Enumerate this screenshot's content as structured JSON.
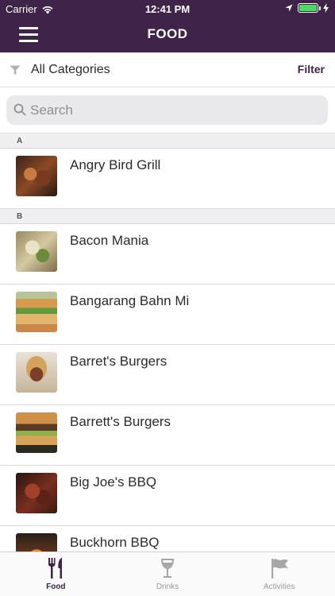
{
  "status_bar": {
    "carrier": "Carrier",
    "time": "12:41 PM",
    "battery_color": "#4cd964"
  },
  "nav": {
    "title": "FOOD",
    "menu_icon": "hamburger-menu-icon",
    "bar_color": "#3f2349"
  },
  "filter": {
    "category": "All Categories",
    "button_label": "Filter",
    "icon": "funnel-icon"
  },
  "search": {
    "placeholder": "Search",
    "value": ""
  },
  "sections": [
    {
      "letter": "A",
      "items": [
        {
          "name": "Angry Bird Grill",
          "thumb": "t1"
        }
      ]
    },
    {
      "letter": "B",
      "items": [
        {
          "name": "Bacon Mania",
          "thumb": "t2"
        },
        {
          "name": "Bangarang Bahn Mi",
          "thumb": "t3"
        },
        {
          "name": "Barret's Burgers",
          "thumb": "t4"
        },
        {
          "name": "Barrett's Burgers",
          "thumb": "t5"
        },
        {
          "name": "Big Joe's BBQ",
          "thumb": "t6"
        },
        {
          "name": "Buckhorn BBQ",
          "thumb": "t7"
        }
      ]
    }
  ],
  "tabs": [
    {
      "label": "Food",
      "icon": "fork-knife-icon",
      "active": true
    },
    {
      "label": "Drinks",
      "icon": "wine-glass-icon",
      "active": false
    },
    {
      "label": "Activities",
      "icon": "flag-icon",
      "active": false
    }
  ]
}
